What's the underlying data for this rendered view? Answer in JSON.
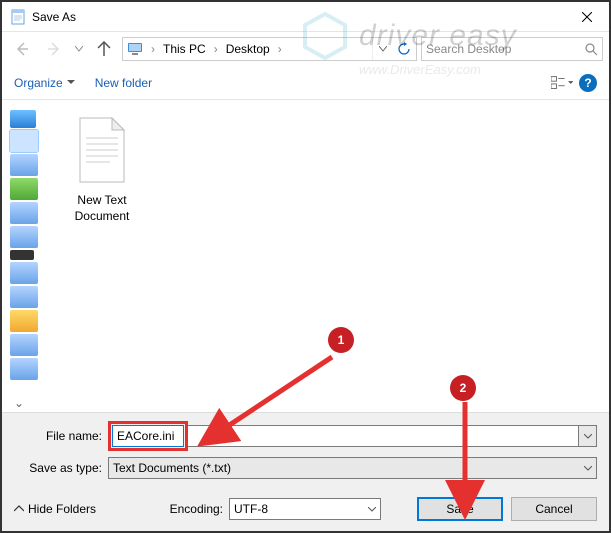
{
  "title": "Save As",
  "breadcrumb": {
    "loc1": "This PC",
    "loc2": "Desktop"
  },
  "search": {
    "placeholder": "Search Desktop"
  },
  "toolbar": {
    "organize": "Organize",
    "newfolder": "New folder"
  },
  "file": {
    "name": "New Text Document"
  },
  "form": {
    "filename_label": "File name:",
    "filename_value": "EACore.ini",
    "type_label": "Save as type:",
    "type_value": "Text Documents (*.txt)",
    "encoding_label": "Encoding:",
    "encoding_value": "UTF-8",
    "hide_folders": "Hide Folders",
    "save": "Save",
    "cancel": "Cancel"
  },
  "callouts": {
    "c1": "1",
    "c2": "2"
  },
  "watermark": {
    "brand": "driver easy",
    "url": "www.DriverEasy.com"
  }
}
